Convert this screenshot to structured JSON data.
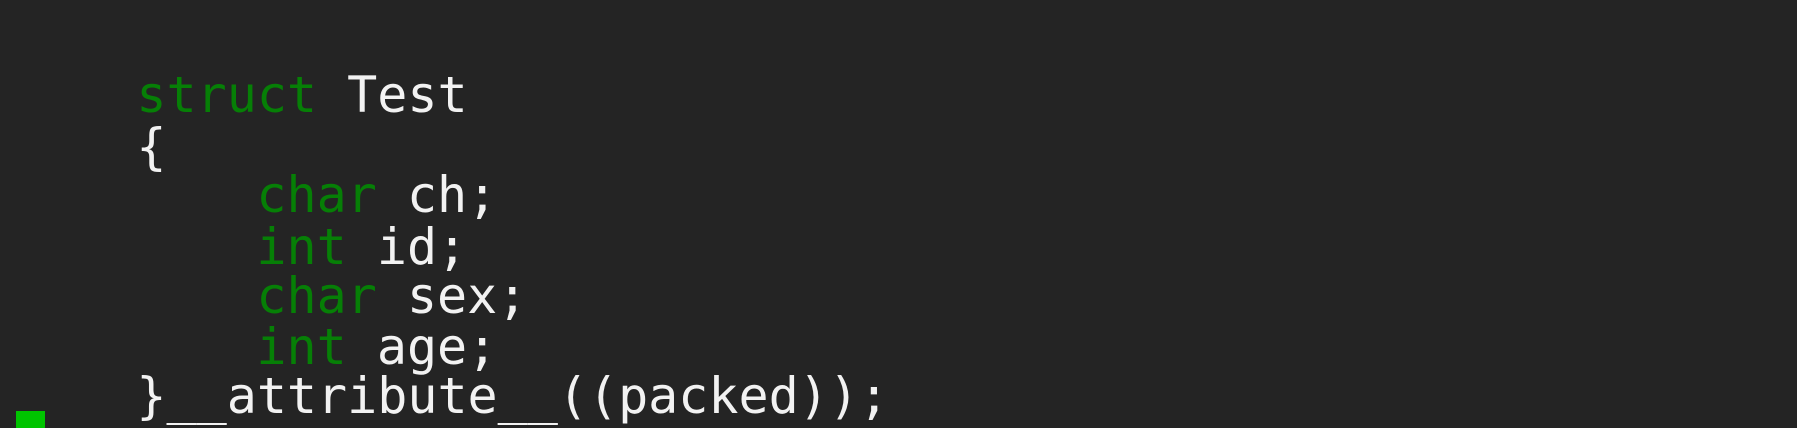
{
  "editor": {
    "theme": {
      "background": "#242424",
      "text": "#f2f2f2",
      "keyword": "#067f06",
      "cursor": "#00c400"
    },
    "lines": [
      {
        "keyword": "struct",
        "text": " Test"
      },
      {
        "text": "{"
      },
      {
        "keyword": "char",
        "text": " ch;"
      },
      {
        "keyword": "int",
        "text": " id;"
      },
      {
        "keyword": "char",
        "text": " sex;"
      },
      {
        "keyword": "int",
        "text": " age;"
      },
      {
        "text": "}__attribute__((packed));"
      }
    ]
  }
}
